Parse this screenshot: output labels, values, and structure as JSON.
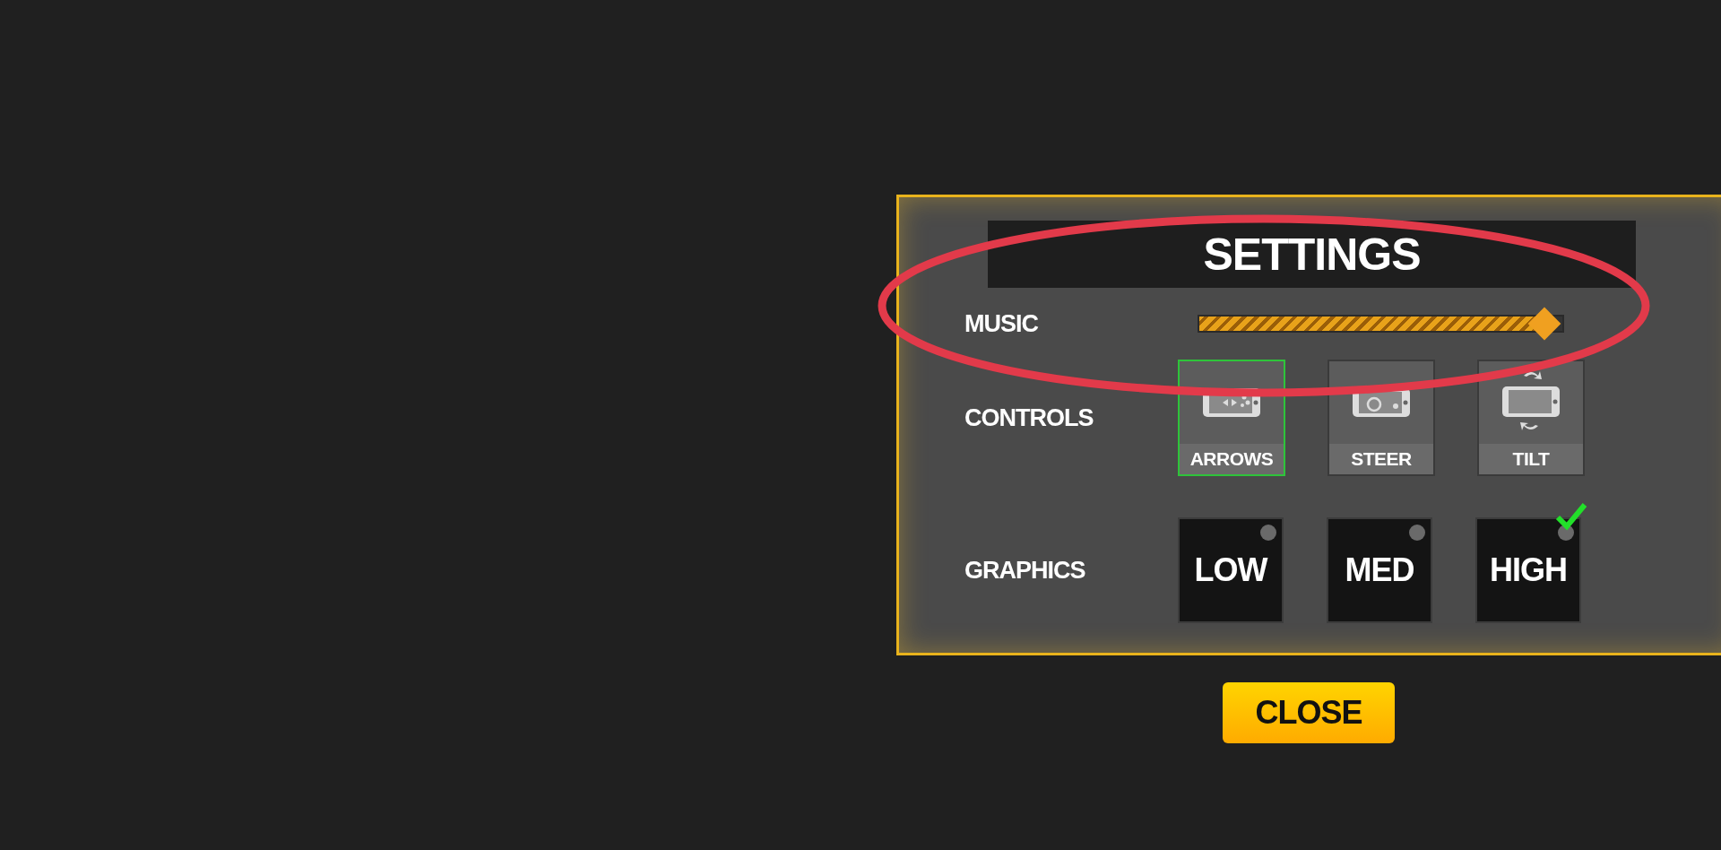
{
  "panel": {
    "title": "SETTINGS"
  },
  "music": {
    "label": "MUSIC",
    "level": 0.95
  },
  "controls": {
    "label": "CONTROLS",
    "options": [
      {
        "label": "ARROWS",
        "kind": "arrows",
        "selected": true
      },
      {
        "label": "STEER",
        "kind": "steer",
        "selected": false
      },
      {
        "label": "TILT",
        "kind": "tilt",
        "selected": false
      }
    ]
  },
  "graphics": {
    "label": "GRAPHICS",
    "options": [
      {
        "label": "LOW",
        "selected": false
      },
      {
        "label": "MED",
        "selected": false
      },
      {
        "label": "HIGH",
        "selected": true
      }
    ]
  },
  "close_button": "CLOSE"
}
